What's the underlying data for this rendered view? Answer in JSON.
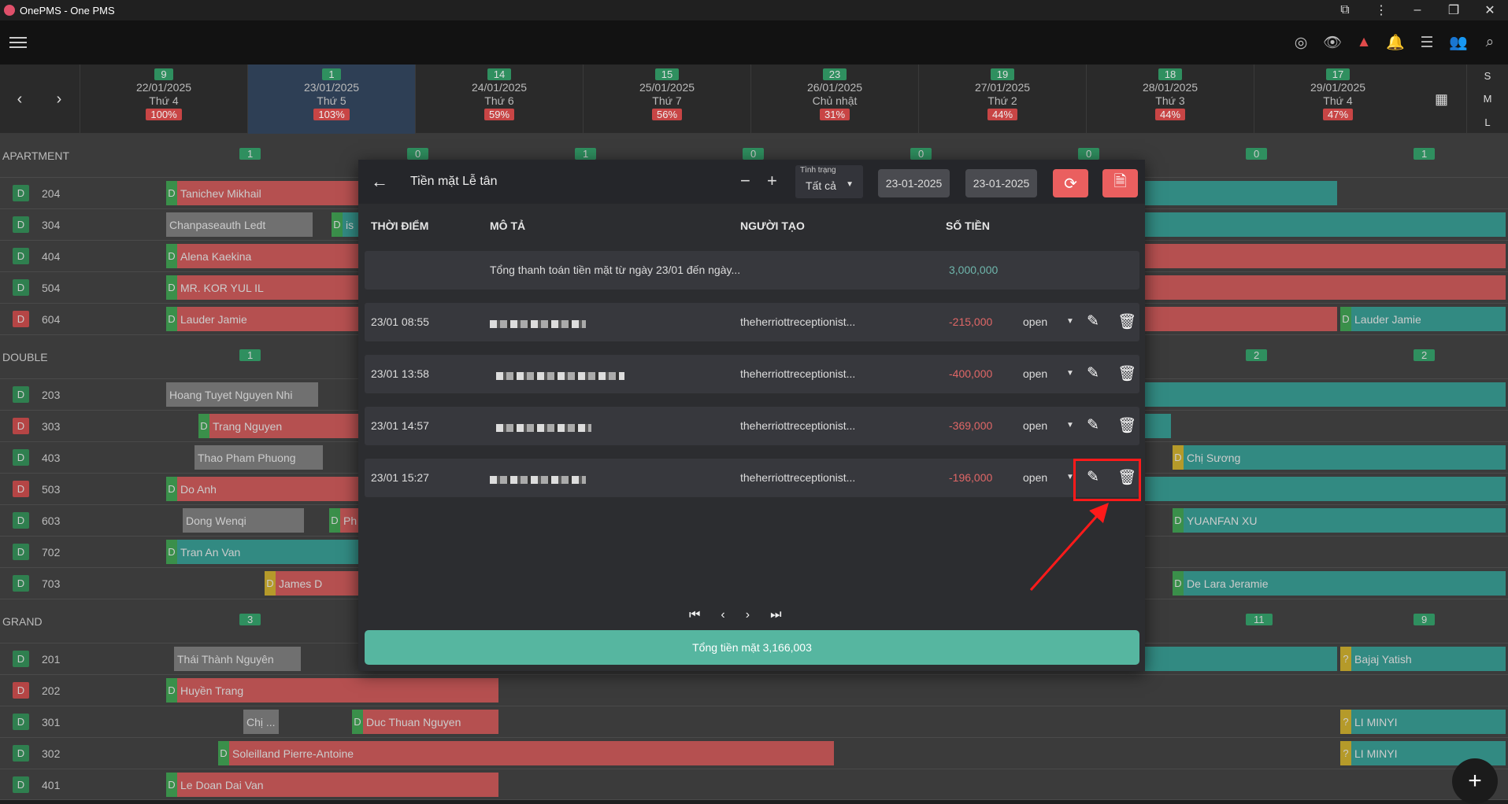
{
  "window": {
    "title": "OnePMS - One PMS"
  },
  "dates": [
    {
      "count": "9",
      "date": "22/01/2025",
      "dow": "Thứ 4",
      "occ": "100%"
    },
    {
      "count": "1",
      "date": "23/01/2025",
      "dow": "Thứ 5",
      "occ": "103%",
      "selected": true
    },
    {
      "count": "14",
      "date": "24/01/2025",
      "dow": "Thứ 6",
      "occ": "59%"
    },
    {
      "count": "15",
      "date": "25/01/2025",
      "dow": "Thứ 7",
      "occ": "56%"
    },
    {
      "count": "23",
      "date": "26/01/2025",
      "dow": "Chủ nhật",
      "occ": "31%"
    },
    {
      "count": "19",
      "date": "27/01/2025",
      "dow": "Thứ 2",
      "occ": "44%"
    },
    {
      "count": "18",
      "date": "28/01/2025",
      "dow": "Thứ 3",
      "occ": "44%"
    },
    {
      "count": "17",
      "date": "29/01/2025",
      "dow": "Thứ 4",
      "occ": "47%"
    }
  ],
  "size_toggle": [
    "S",
    "M",
    "L"
  ],
  "groups": {
    "apartment": {
      "name": "APARTMENT",
      "counts": [
        "1",
        "0",
        "1",
        "0",
        "0",
        "0",
        "0",
        "1"
      ]
    },
    "double": {
      "name": "DOUBLE",
      "counts": [
        "1",
        "2",
        "2"
      ]
    },
    "grand": {
      "name": "GRAND",
      "counts": [
        "3",
        "11",
        "9"
      ]
    }
  },
  "rooms": {
    "r204": "204",
    "r304": "304",
    "r404": "404",
    "r504": "504",
    "r604": "604",
    "r203": "203",
    "r303": "303",
    "r403": "403",
    "r503": "503",
    "r603": "603",
    "r702": "702",
    "r703": "703",
    "r201": "201",
    "r202": "202",
    "r301": "301",
    "r302": "302",
    "r401": "401"
  },
  "badge_letter": "D",
  "guests": {
    "g1": "Tanichev Mikhail",
    "g2": "Chanpaseauth Ledt",
    "g3": "Alena Kaekina",
    "g4": "MR. KOR YUL IL",
    "g5": "Lauder Jamie",
    "g6": "Lauder Jamie",
    "g7": "Hoang Tuyet Nguyen Nhi",
    "g8": "Trang Nguyen",
    "g9": "Thao Pham Phuong",
    "g10": "Chị Sương",
    "g11": "Do Anh",
    "g12": "Dong Wenqi",
    "g13": "YUANFAN XU",
    "g14": "Tran An Van",
    "g15": "James D",
    "g16": "De Lara Jeramie",
    "g17": "Thái Thành Nguyên",
    "g18": "Bajaj Yatish",
    "g19": "Huyền Trang",
    "g20": "Chị ...",
    "g21": "Duc Thuan Nguyen",
    "g22": "LI MINYI",
    "g23": "Soleilland Pierre-Antoine",
    "g24": "LI MINYI",
    "g25": "Le Doan Dai Van",
    "g26": "is",
    "g27": "Ph"
  },
  "modal": {
    "title": "Tiền mặt Lễ tân",
    "minus": "−",
    "plus": "+",
    "status_label": "Tình trạng",
    "status_value": "Tất cả",
    "date_from": "23-01-2025",
    "date_to": "23-01-2025",
    "headers": {
      "time": "THỜI ĐIỂM",
      "desc": "MÔ TẢ",
      "creator": "NGƯỜI TẠO",
      "amount": "SỐ TIỀN"
    },
    "summary": {
      "desc": "Tổng thanh toán tiền mặt từ ngày 23/01 đến ngày...",
      "amount": "3,000,000"
    },
    "rows": [
      {
        "time": "23/01 08:55",
        "creator": "theherriottreceptionist...",
        "amount": "-215,000",
        "status": "open"
      },
      {
        "time": "23/01 13:58",
        "creator": "theherriottreceptionist...",
        "amount": "-400,000",
        "status": "open"
      },
      {
        "time": "23/01 14:57",
        "creator": "theherriottreceptionist...",
        "amount": "-369,000",
        "status": "open"
      },
      {
        "time": "23/01 15:27",
        "creator": "theherriottreceptionist...",
        "amount": "-196,000",
        "status": "open"
      }
    ],
    "total": "Tổng tiền mặt 3,166,003"
  },
  "icons": {
    "accent": "#56b6a0",
    "danger": "#ea5f5f",
    "highlight": "#ff1a1a"
  }
}
